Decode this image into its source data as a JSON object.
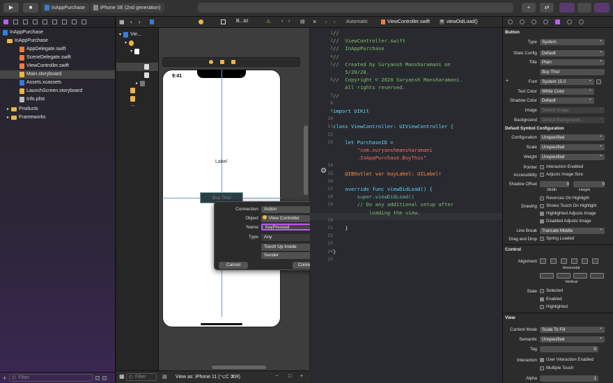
{
  "toolbar": {
    "scheme_target": "InAppPurchase",
    "scheme_device": "iPhone SE (2nd generation)",
    "run_icon": "play-icon",
    "stop_icon": "stop-icon"
  },
  "navigator": {
    "items": [
      {
        "label": "InAppPurchase",
        "kind": "project",
        "level": 0
      },
      {
        "label": "InAppPurchase",
        "kind": "folder",
        "level": 1
      },
      {
        "label": "AppDelegate.swift",
        "kind": "swift",
        "level": 2
      },
      {
        "label": "SceneDelegate.swift",
        "kind": "swift",
        "level": 2
      },
      {
        "label": "ViewController.swift",
        "kind": "swift",
        "level": 2
      },
      {
        "label": "Main.storyboard",
        "kind": "storyboard",
        "level": 2,
        "selected": true
      },
      {
        "label": "Assets.xcassets",
        "kind": "assets",
        "level": 2
      },
      {
        "label": "LaunchScreen.storyboard",
        "kind": "storyboard",
        "level": 2
      },
      {
        "label": "Info.plist",
        "kind": "plist",
        "level": 2
      },
      {
        "label": "Products",
        "kind": "folder",
        "level": 1
      },
      {
        "label": "Frameworks",
        "kind": "folder",
        "level": 1
      }
    ],
    "filter_placeholder": "Filter"
  },
  "ib": {
    "jump_last": "B...is!",
    "outline_first": "Vie...",
    "outline_filter": "Filter",
    "view_as": "View as: iPhone 11 (⌥C ⌘R)",
    "time": "9:41",
    "label_text": "Label",
    "button_text": "Buy This!"
  },
  "popover": {
    "connection_label": "Connection",
    "connection_value": "Action",
    "object_label": "Object",
    "object_value": "View Controller",
    "name_label": "Name",
    "name_value": "buyPressed",
    "type_label": "Type",
    "type_value": "Any",
    "event_value": "Touch Up Inside",
    "arguments_value": "Sender",
    "cancel": "Cancel",
    "connect": "Connect"
  },
  "editor": {
    "jump_mode": "Automatic",
    "jump_file": "ViewController.swift",
    "jump_symbol": "viewDidLoad()",
    "lines": [
      {
        "n": "1",
        "t": "//"
      },
      {
        "n": "2",
        "t": "//  ViewController.swift"
      },
      {
        "n": "3",
        "t": "//  InAppPurchase"
      },
      {
        "n": "4",
        "t": "//"
      },
      {
        "n": "5",
        "t": "//  Created by Suryansh Mansharamani on"
      },
      {
        "n": "",
        "t": "    5/20/20."
      },
      {
        "n": "6",
        "t": "//  Copyright © 2020 Suryansh Mansharamani."
      },
      {
        "n": "",
        "t": "    All rights reserved."
      },
      {
        "n": "7",
        "t": "//"
      },
      {
        "n": "8",
        "t": ""
      },
      {
        "n": "9",
        "t": "import UIKit"
      },
      {
        "n": "10",
        "t": ""
      },
      {
        "n": "11",
        "t": "class ViewController: UIViewController {"
      },
      {
        "n": "12",
        "t": ""
      },
      {
        "n": "13",
        "t": "    let PurchaseID ="
      },
      {
        "n": "",
        "t": "        \"com.suryanshmansharamani"
      },
      {
        "n": "",
        "t": "        .InAppPurchase.BuyThis\""
      },
      {
        "n": "14",
        "t": ""
      },
      {
        "n": "15",
        "t": "    @IBOutlet var buyLabel: UILabel!"
      },
      {
        "n": "16",
        "t": ""
      },
      {
        "n": "17",
        "t": "    override func viewDidLoad() {"
      },
      {
        "n": "18",
        "t": "        super.viewDidLoad()"
      },
      {
        "n": "19",
        "t": "        // Do any additional setup after"
      },
      {
        "n": "",
        "t": "            loading the view."
      },
      {
        "n": "20",
        "t": ""
      },
      {
        "n": "21",
        "t": "    }"
      },
      {
        "n": "22",
        "t": ""
      },
      {
        "n": "23",
        "t": ""
      },
      {
        "n": "24",
        "t": "}"
      },
      {
        "n": "25",
        "t": ""
      }
    ]
  },
  "inspector": {
    "section_button": "Button",
    "type_label": "Type",
    "type_value": "System",
    "state_config_label": "State Config",
    "state_config_value": "Default",
    "title_label": "Title",
    "title_value": "Plain",
    "title_text": "Buy This!",
    "font_label": "Font",
    "font_value": "System 15.0",
    "text_color_label": "Text Color",
    "text_color_value": "White Color",
    "shadow_color_label": "Shadow Color",
    "shadow_color_value": "Default",
    "image_label": "Image",
    "image_value": "Default Image",
    "background_label": "Background",
    "background_value": "Default Background...",
    "symbol_config_title": "Default Symbol Configuration",
    "configuration_label": "Configuration",
    "configuration_value": "Unspecified",
    "scale_label": "Scale",
    "scale_value": "Unspecified",
    "weight_label": "Weight",
    "weight_value": "Unspecified",
    "pointer_label": "Pointer",
    "pointer_value": "Interaction Enabled",
    "accessibility_label": "Accessibility",
    "accessibility_value": "Adjusts Image Size",
    "shadow_offset_label": "Shadow Offset",
    "shadow_w": "0",
    "shadow_h": "0",
    "width_label": "Width",
    "height_label": "Height",
    "reverses": "Reverses On Highlight",
    "drawing_label": "Drawing",
    "shows_touch": "Shows Touch On Highlight",
    "highlighted_adjusts": "Highlighted Adjusts Image",
    "disabled_adjusts": "Disabled Adjusts Image",
    "line_break_label": "Line Break",
    "line_break_value": "Truncate Middle",
    "drag_drop_label": "Drag and Drop",
    "drag_drop_value": "Spring Loaded",
    "section_control": "Control",
    "alignment_label": "Alignment",
    "horizontal_label": "Horizontal",
    "vertical_label": "Vertical",
    "state_label": "State",
    "state_selected": "Selected",
    "state_enabled": "Enabled",
    "state_highlighted": "Highlighted",
    "section_view": "View",
    "content_mode_label": "Content Mode",
    "content_mode_value": "Scale To Fill",
    "semantic_label": "Semantic",
    "semantic_value": "Unspecified",
    "tag_label": "Tag",
    "tag_value": "0",
    "interaction_label": "Interaction",
    "user_interaction": "User Interaction Enabled",
    "multiple_touch": "Multiple Touch",
    "alpha_label": "Alpha",
    "alpha_value": "1"
  }
}
